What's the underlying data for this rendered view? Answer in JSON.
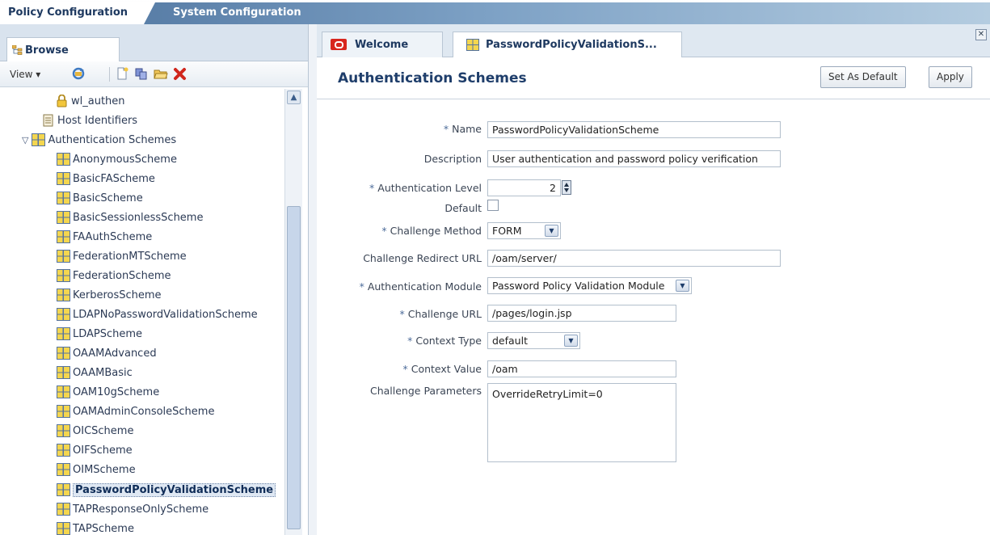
{
  "top_tabs": {
    "policy": "Policy Configuration",
    "system": "System Configuration"
  },
  "left": {
    "browse_tab": "Browse",
    "view_menu": "View ▾",
    "tree": [
      {
        "label": "wl_authen",
        "icon": "lock-icon"
      },
      {
        "label": "Host Identifiers",
        "icon": "document-icon"
      },
      {
        "label": "Authentication Schemes",
        "icon": "scheme-folder-icon",
        "expander": "▽"
      },
      {
        "label": "AnonymousScheme"
      },
      {
        "label": "BasicFAScheme"
      },
      {
        "label": "BasicScheme"
      },
      {
        "label": "BasicSessionlessScheme"
      },
      {
        "label": "FAAuthScheme"
      },
      {
        "label": "FederationMTScheme"
      },
      {
        "label": "FederationScheme"
      },
      {
        "label": "KerberosScheme"
      },
      {
        "label": "LDAPNoPasswordValidationScheme"
      },
      {
        "label": "LDAPScheme"
      },
      {
        "label": "OAAMAdvanced"
      },
      {
        "label": "OAAMBasic"
      },
      {
        "label": "OAM10gScheme"
      },
      {
        "label": "OAMAdminConsoleScheme"
      },
      {
        "label": "OICScheme"
      },
      {
        "label": "OIFScheme"
      },
      {
        "label": "OIMScheme"
      },
      {
        "label": "PasswordPolicyValidationScheme",
        "selected": true
      },
      {
        "label": "TAPResponseOnlyScheme"
      },
      {
        "label": "TAPScheme"
      }
    ]
  },
  "right": {
    "tabs": {
      "welcome": "Welcome",
      "password_policy": "PasswordPolicyValidationS..."
    },
    "title": "Authentication Schemes",
    "buttons": {
      "set_default": "Set As Default",
      "apply": "Apply"
    },
    "form": {
      "name_label": "Name",
      "name_value": "PasswordPolicyValidationScheme",
      "description_label": "Description",
      "description_value": "User authentication and password policy verification",
      "auth_level_label": "Authentication Level",
      "auth_level_value": "2",
      "default_label": "Default",
      "challenge_method_label": "Challenge Method",
      "challenge_method_value": "FORM",
      "redirect_label": "Challenge Redirect URL",
      "redirect_value": "/oam/server/",
      "module_label": "Authentication Module",
      "module_value": "Password Policy Validation Module",
      "challenge_url_label": "Challenge URL",
      "challenge_url_value": "/pages/login.jsp",
      "context_type_label": "Context Type",
      "context_type_value": "default",
      "context_value_label": "Context Value",
      "context_value_value": "/oam",
      "params_label": "Challenge Parameters",
      "params_value": "OverrideRetryLimit=0"
    }
  }
}
